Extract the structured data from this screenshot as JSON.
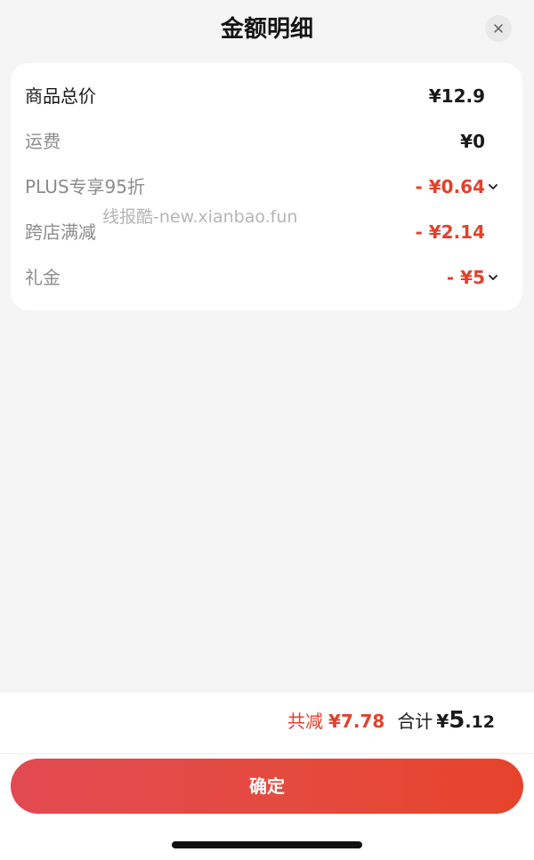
{
  "header": {
    "title": "金额明细",
    "close_icon": "close-icon"
  },
  "breakdown": {
    "rows": [
      {
        "label": "商品总价",
        "value": "¥12.9",
        "type": "normal",
        "expandable": false
      },
      {
        "label": "运费",
        "value": "¥0",
        "type": "normal",
        "expandable": false
      },
      {
        "label": "PLUS专享95折",
        "value": "- ¥0.64",
        "type": "discount",
        "expandable": true
      },
      {
        "label": "跨店满减",
        "value": "- ¥2.14",
        "type": "discount",
        "expandable": false
      },
      {
        "label": "礼金",
        "value": "- ¥5",
        "type": "discount",
        "expandable": true
      }
    ]
  },
  "watermark": "线报酷-new.xianbao.fun",
  "footer": {
    "saved_label": "共减",
    "saved_amount": "¥7.78",
    "total_label": "合计",
    "total_currency": "¥",
    "total_integer": "5",
    "total_decimal": ".12",
    "confirm_label": "确定"
  },
  "colors": {
    "accent": "#e2412c",
    "button_gradient_start": "#e24a52",
    "button_gradient_end": "#e6432c",
    "background": "#f5f5f5",
    "card": "#ffffff"
  }
}
